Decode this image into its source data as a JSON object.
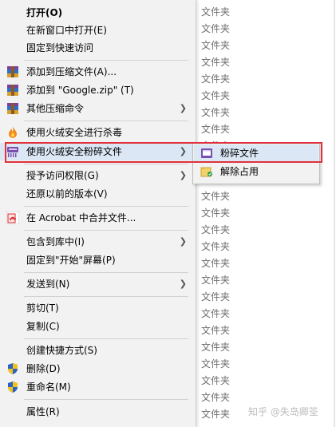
{
  "files": [
    "文件夹",
    "文件夹",
    "文件夹",
    "文件夹",
    "文件夹",
    "文件夹",
    "文件夹",
    "文件夹",
    "文件夹",
    "文件夹",
    "文件夹",
    "文件夹",
    "文件夹",
    "文件夹",
    "文件夹",
    "文件夹",
    "文件夹",
    "文件夹",
    "文件夹",
    "文件夹",
    "文件夹",
    "文件夹",
    "文件夹",
    "文件夹",
    "文件夹"
  ],
  "menu": {
    "open": "打开(O)",
    "open_new_window": "在新窗口中打开(E)",
    "pin_quick_access": "固定到快速访问",
    "add_archive": "添加到压缩文件(A)...",
    "add_google_zip": "添加到 \"Google.zip\" (T)",
    "other_compress": "其他压缩命令",
    "huorong_scan": "使用火绒安全进行杀毒",
    "huorong_shred": "使用火绒安全粉碎文件",
    "grant_access": "授予访问权限(G)",
    "restore_previous": "还原以前的版本(V)",
    "acrobat_combine": "在 Acrobat 中合并文件...",
    "include_library": "包含到库中(I)",
    "pin_start": "固定到\"开始\"屏幕(P)",
    "send_to": "发送到(N)",
    "cut": "剪切(T)",
    "copy": "复制(C)",
    "create_shortcut": "创建快捷方式(S)",
    "delete": "删除(D)",
    "rename": "重命名(M)",
    "properties": "属性(R)"
  },
  "submenu": {
    "shred_file": "粉碎文件",
    "release_occupation": "解除占用"
  },
  "watermark": "知乎 @失岛卿筌",
  "colors": {
    "highlight_box": "#e0323c",
    "menu_bg": "#f2f2f2",
    "hover_bg": "#dbe7f4"
  }
}
